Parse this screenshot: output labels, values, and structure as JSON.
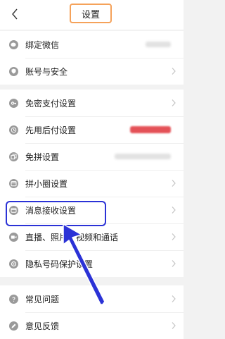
{
  "header": {
    "title": "设置",
    "back_icon": "chevron-left-icon"
  },
  "groups": [
    {
      "rows": [
        {
          "label": "绑定微信",
          "icon": "wechat-icon",
          "right": "blurred-text"
        },
        {
          "label": "账号与安全",
          "icon": "shield-icon",
          "right": "chevron"
        }
      ]
    },
    {
      "rows": [
        {
          "label": "免密支付设置",
          "icon": "key-icon",
          "right": "chevron"
        },
        {
          "label": "先用后付设置",
          "icon": "clock-icon",
          "right": "blurred-red"
        },
        {
          "label": "免拼设置",
          "icon": "copy-icon",
          "right": "blurred-text"
        },
        {
          "label": "拼小圈设置",
          "icon": "calendar-icon",
          "right": "chevron"
        },
        {
          "label": "消息接收设置",
          "icon": "message-icon",
          "right": "chevron"
        },
        {
          "label": "直播、照片、视频和通话",
          "icon": "video-icon",
          "right": "chevron"
        },
        {
          "label": "隐私号码保护设置",
          "icon": "privacy-icon",
          "right": "chevron"
        }
      ]
    },
    {
      "rows": [
        {
          "label": "常见问题",
          "icon": "question-icon",
          "right": "chevron"
        },
        {
          "label": "意见反馈",
          "icon": "feedback-icon",
          "right": "chevron"
        }
      ]
    }
  ],
  "annotation": {
    "highlight_color": "#2b32d6",
    "title_box_color": "#f5a25a",
    "arrow_icon": "pointer-arrow-icon"
  }
}
